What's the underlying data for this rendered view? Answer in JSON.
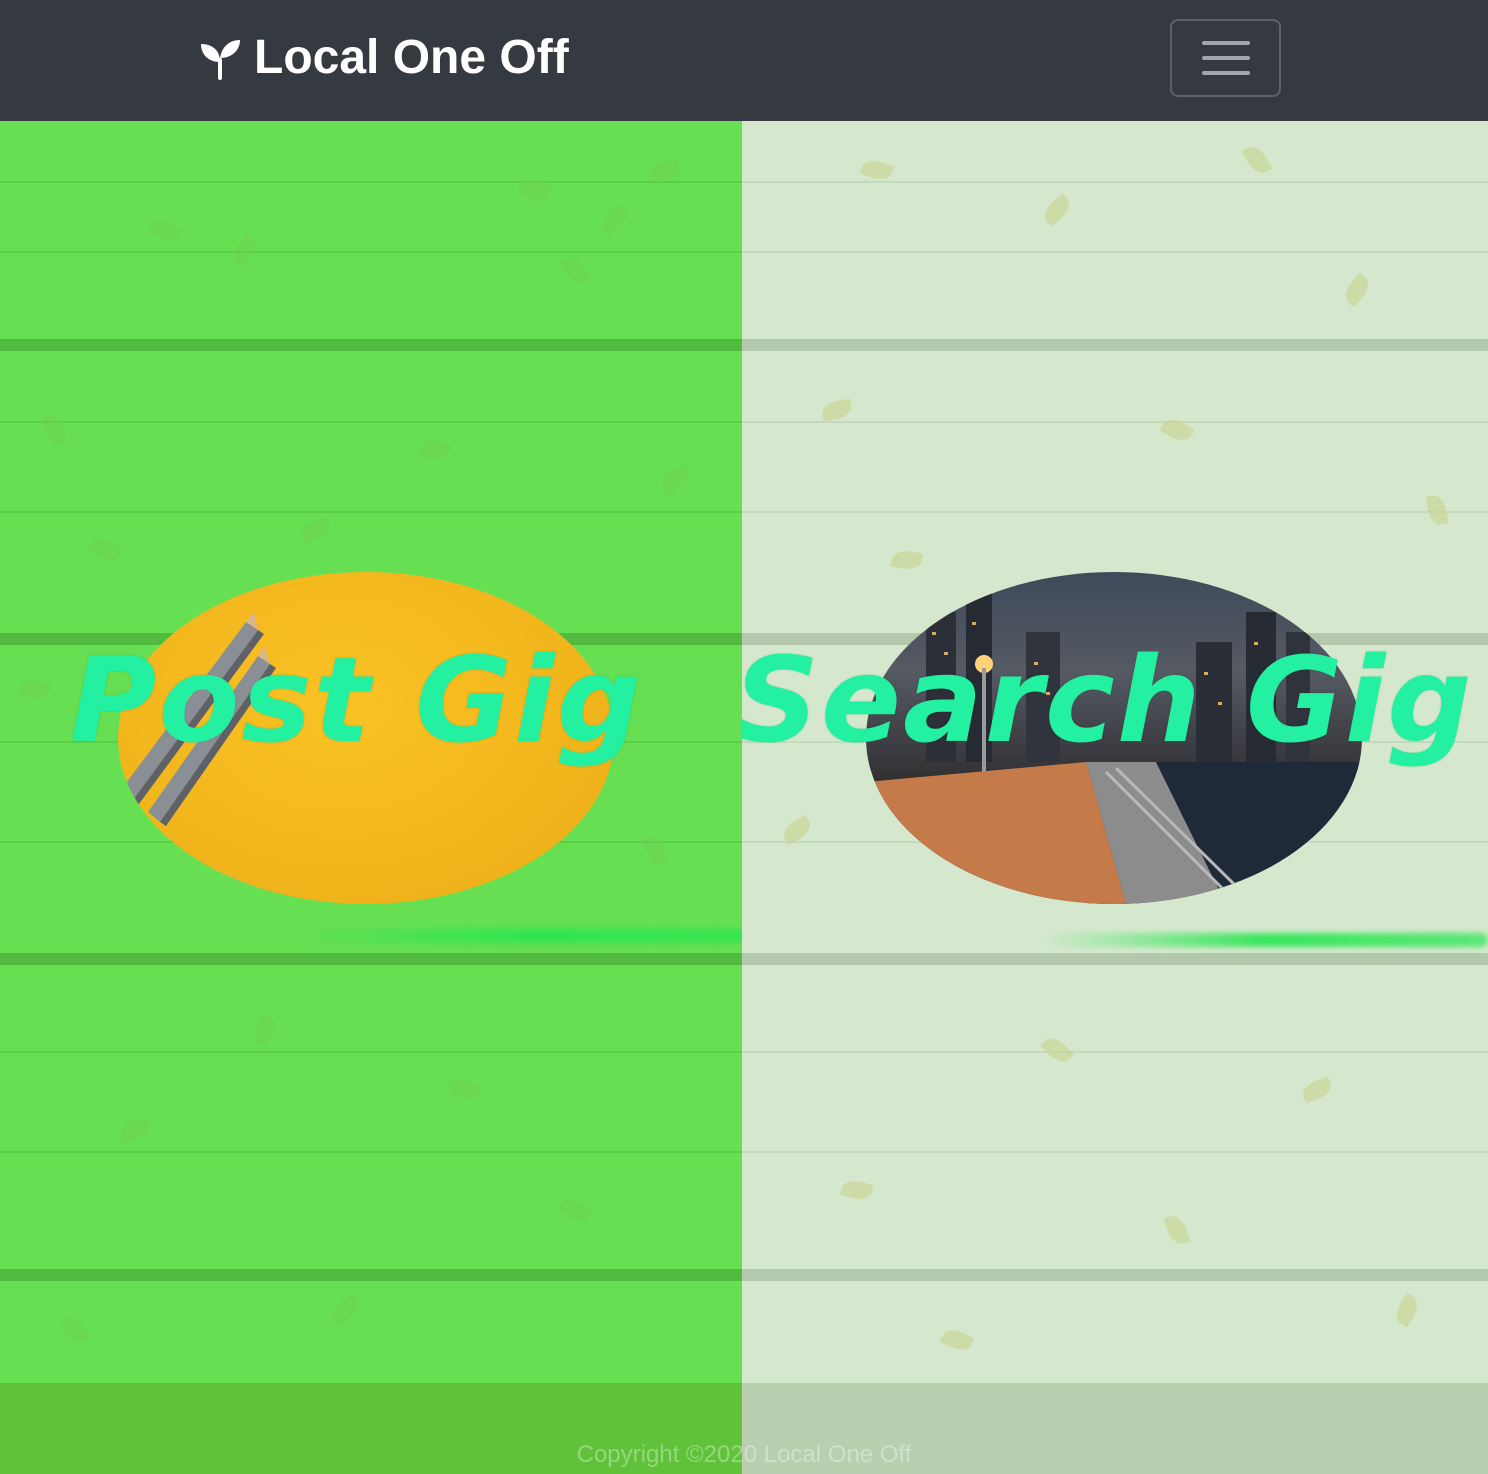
{
  "navbar": {
    "brand_icon": "seedling-icon",
    "brand_text": "Local One Off",
    "toggler_icon": "hamburger-menu-icon",
    "background_color": "#343a40"
  },
  "panels": {
    "post": {
      "title": "Post Gig",
      "image": "pencils-on-yellow-paper",
      "overlay_color": "#66df52"
    },
    "search": {
      "title": "Search Gig",
      "image": "city-waterfront-promenade-at-night",
      "overlay_color": "#d5e8ce"
    }
  },
  "title_color": "#23f0a0",
  "footer": {
    "copyright": "Copyright ©2020 Local One Off"
  }
}
